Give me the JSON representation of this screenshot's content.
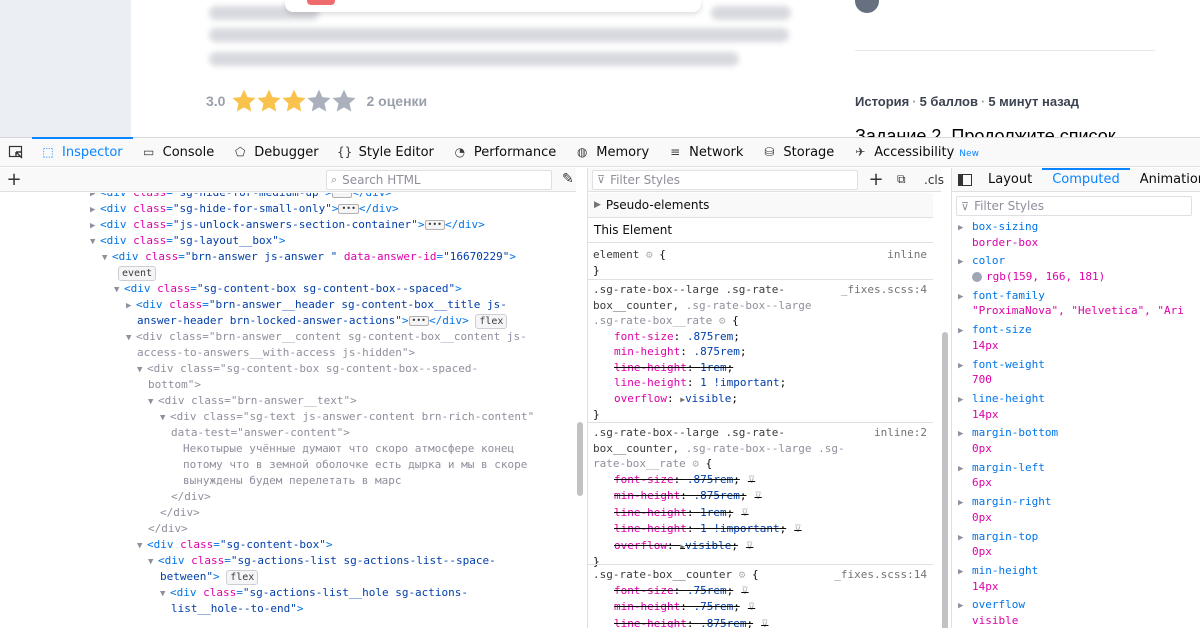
{
  "page": {
    "rating_value": "3.0",
    "rating_stars": 3,
    "rating_max": 5,
    "rating_count": "2 оценки",
    "history": [
      "История",
      "5 баллов",
      "5 минут назад"
    ],
    "task_title": "Задание 2. Продолжите список"
  },
  "toolbar": {
    "tabs": [
      {
        "label": "Inspector",
        "icon": "inspector-icon"
      },
      {
        "label": "Console",
        "icon": "console-icon"
      },
      {
        "label": "Debugger",
        "icon": "debugger-icon"
      },
      {
        "label": "Style Editor",
        "icon": "style-editor-icon"
      },
      {
        "label": "Performance",
        "icon": "performance-icon"
      },
      {
        "label": "Memory",
        "icon": "memory-icon"
      },
      {
        "label": "Network",
        "icon": "network-icon"
      },
      {
        "label": "Storage",
        "icon": "storage-icon"
      },
      {
        "label": "Accessibility",
        "icon": "accessibility-icon",
        "badge": "New"
      }
    ],
    "selected_tab": "Inspector"
  },
  "markup": {
    "search_placeholder": "Search HTML",
    "text_content": [
      "Некотырые учённые думают что скоро атмосфере конец",
      "потому что в земной оболочке есть дырка и мы в скоре",
      "вынуждены будем перелетать в марс"
    ],
    "badges": {
      "event": "event",
      "flex": "flex"
    }
  },
  "rules": {
    "filter_placeholder": "Filter Styles",
    "cls_label": ".cls",
    "pseudo_label": "Pseudo-elements",
    "this_element_label": "This Element",
    "element_selector": "element",
    "element_source": "inline",
    "rule1": {
      "selector_a": ".sg-rate-box--large .sg-rate-",
      "selector_b": "box__counter, ",
      "selector_c": ".sg-rate-box--large",
      "selector_d": ".sg-rate-box__rate",
      "source": "_fixes.scss:4"
    },
    "rule2": {
      "selector_a": ".sg-rate-box--large .sg-rate-",
      "selector_b": "box__counter, ",
      "selector_c": ".sg-rate-box--large .sg-",
      "selector_d": "rate-box__rate",
      "source": "inline:2"
    },
    "rule3": {
      "selector": ".sg-rate-box__counter",
      "source": "_fixes.scss:14"
    }
  },
  "computed": {
    "tabs": [
      "Layout",
      "Computed",
      "Animations"
    ],
    "selected_tab": "Computed",
    "filter_placeholder": "Filter Styles",
    "swatch_color": "#9fa6b5",
    "props": [
      {
        "name": "box-sizing",
        "value": "border-box"
      },
      {
        "name": "color",
        "value": "rgb(159, 166, 181)"
      },
      {
        "name": "font-family",
        "value": "\"ProximaNova\", \"Helvetica\", \"Ari"
      },
      {
        "name": "font-size",
        "value": "14px"
      },
      {
        "name": "font-weight",
        "value": "700"
      },
      {
        "name": "line-height",
        "value": "14px"
      },
      {
        "name": "margin-bottom",
        "value": "0px"
      },
      {
        "name": "margin-left",
        "value": "6px"
      },
      {
        "name": "margin-right",
        "value": "0px"
      },
      {
        "name": "margin-top",
        "value": "0px"
      },
      {
        "name": "min-height",
        "value": "14px"
      },
      {
        "name": "overflow",
        "value": "visible"
      }
    ]
  },
  "colors": {
    "accent": "#0a84ff",
    "star_on": "#f8c24c",
    "star_off": "#aab1bd"
  }
}
